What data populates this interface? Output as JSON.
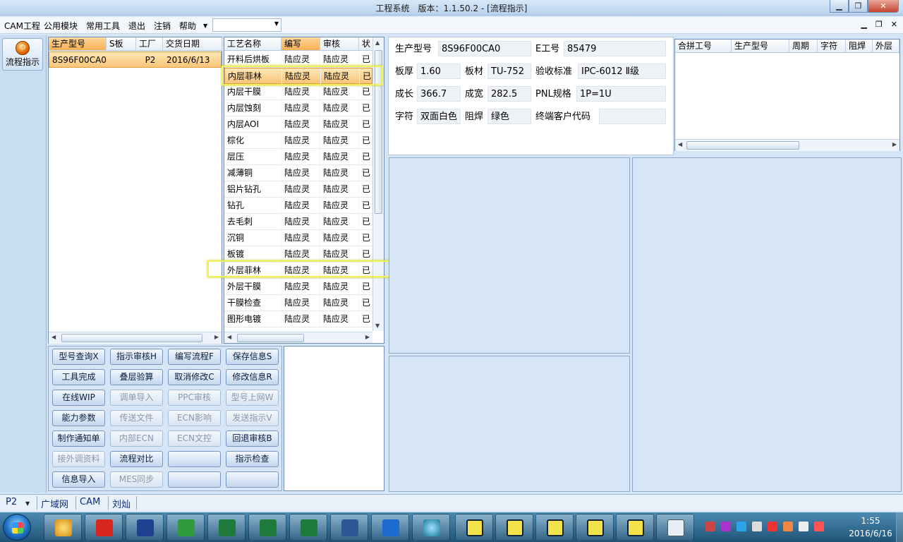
{
  "window": {
    "title": "工程系统　版本：1.1.50.2 - [流程指示]"
  },
  "menu": {
    "items": [
      "CAM工程",
      "公用模块",
      "常用工具",
      "退出",
      "注销",
      "帮助"
    ],
    "combo_value": ""
  },
  "left_toolbar": {
    "flow_label": "流程指示"
  },
  "model_list": {
    "columns": [
      "生产型号",
      "S板",
      "工厂",
      "交货日期"
    ],
    "rows": [
      {
        "model": "8S96F00CA0",
        "s": "",
        "factory": "P2",
        "date": "2016/6/13"
      }
    ]
  },
  "process_table": {
    "columns": [
      "工艺名称",
      "编写",
      "审核",
      "状"
    ],
    "rows": [
      [
        "开料后烘板",
        "陆应灵",
        "陆应灵",
        "已"
      ],
      [
        "内层菲林",
        "陆应灵",
        "陆应灵",
        "已"
      ],
      [
        "内层干膜",
        "陆应灵",
        "陆应灵",
        "已"
      ],
      [
        "内层蚀刻",
        "陆应灵",
        "陆应灵",
        "已"
      ],
      [
        "内层AOI",
        "陆应灵",
        "陆应灵",
        "已"
      ],
      [
        "棕化",
        "陆应灵",
        "陆应灵",
        "已"
      ],
      [
        "层压",
        "陆应灵",
        "陆应灵",
        "已"
      ],
      [
        "减薄铜",
        "陆应灵",
        "陆应灵",
        "已"
      ],
      [
        "铝片钻孔",
        "陆应灵",
        "陆应灵",
        "已"
      ],
      [
        "钻孔",
        "陆应灵",
        "陆应灵",
        "已"
      ],
      [
        "去毛刺",
        "陆应灵",
        "陆应灵",
        "已"
      ],
      [
        "沉铜",
        "陆应灵",
        "陆应灵",
        "已"
      ],
      [
        "板镀",
        "陆应灵",
        "陆应灵",
        "已"
      ],
      [
        "外层菲林",
        "陆应灵",
        "陆应灵",
        "已"
      ],
      [
        "外层干膜",
        "陆应灵",
        "陆应灵",
        "已"
      ],
      [
        "干膜检查",
        "陆应灵",
        "陆应灵",
        "已"
      ],
      [
        "图形电镀",
        "陆应灵",
        "陆应灵",
        "已"
      ]
    ]
  },
  "info": {
    "model_label": "生产型号",
    "model_value": "8S96F00CA0",
    "eno_label": "E工号",
    "eno_value": "85479",
    "thick_label": "板厚",
    "thick_value": "1.60",
    "mat_label": "板材",
    "mat_value": "TU-752",
    "std_label": "验收标准",
    "std_value": "IPC-6012 Ⅱ级",
    "len_label": "成长",
    "len_value": "366.7",
    "wid_label": "成宽",
    "wid_value": "282.5",
    "pnl_label": "PNL规格",
    "pnl_value": "1P=1U",
    "char_label": "字符",
    "char_value": "双面白色",
    "mask_label": "阻焊",
    "mask_value": "绿色",
    "cust_label": "终端客户代码",
    "cust_value": ""
  },
  "merge_table": {
    "columns": [
      "合拼工号",
      "生产型号",
      "周期",
      "字符",
      "阻焊",
      "外层"
    ]
  },
  "actions": {
    "row1": [
      "型号查询X",
      "指示审核H",
      "编写流程F",
      "保存信息S"
    ],
    "row2": [
      "工具完成",
      "叠层验算",
      "取消修改C",
      "修改信息R"
    ],
    "row3": [
      "在线WIP",
      "调单导入",
      "PPC审核",
      "型号上网W"
    ],
    "row4": [
      "能力参数",
      "传送文件",
      "ECN影响",
      "发送指示V"
    ],
    "row5": [
      "制作通知单",
      "内部ECN",
      "ECN文控",
      "回退审核B"
    ],
    "row6": [
      "接外调资料",
      "流程对比",
      "",
      "指示检查"
    ],
    "row7": [
      "信息导入",
      "MES同步",
      "",
      ""
    ]
  },
  "status": {
    "factory": "P2",
    "net": "广域网",
    "dept": "CAM",
    "user": "刘灿"
  },
  "clock": {
    "time": "1:55",
    "date": "2016/6/16"
  },
  "colors": {
    "accent": "#f7b054",
    "highlight_box": "#f0f05a",
    "excel": "#1e7a3a",
    "word": "#2b5797"
  }
}
